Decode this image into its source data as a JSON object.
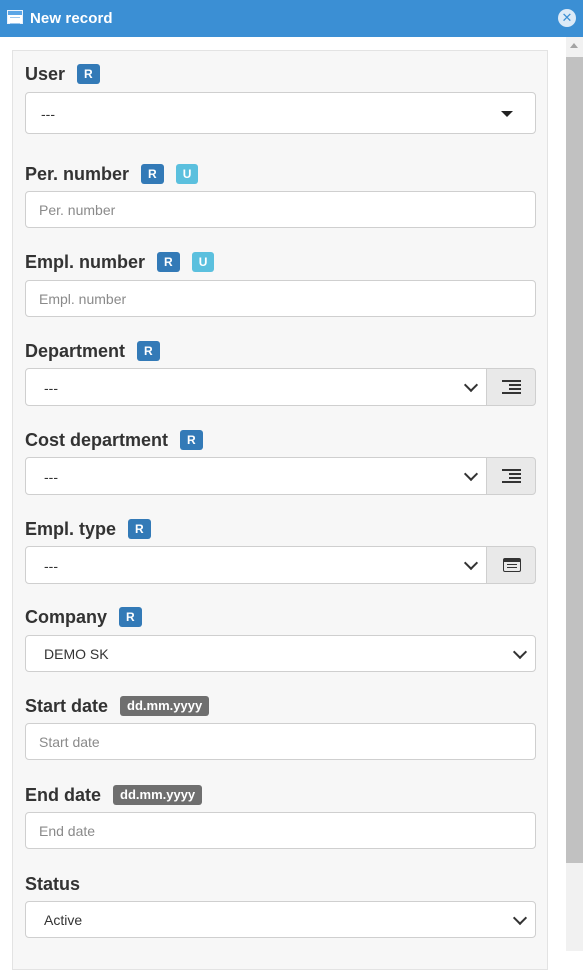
{
  "window": {
    "title": "New record"
  },
  "badges": {
    "r": "R",
    "u": "U",
    "date_format": "dd.mm.yyyy"
  },
  "fields": {
    "user": {
      "label": "User",
      "value": "---"
    },
    "per_number": {
      "label": "Per. number",
      "placeholder": "Per. number"
    },
    "empl_number": {
      "label": "Empl. number",
      "placeholder": "Empl. number"
    },
    "department": {
      "label": "Department",
      "value": "---"
    },
    "cost_department": {
      "label": "Cost department",
      "value": "---"
    },
    "empl_type": {
      "label": "Empl. type",
      "value": "---"
    },
    "company": {
      "label": "Company",
      "value": "DEMO SK"
    },
    "start_date": {
      "label": "Start date",
      "placeholder": "Start date"
    },
    "end_date": {
      "label": "End date",
      "placeholder": "End date"
    },
    "status": {
      "label": "Status",
      "value": "Active"
    }
  },
  "icons": {
    "window": "window-icon",
    "close": "close-icon",
    "tree": "indent-list-icon",
    "list": "list-icon"
  },
  "colors": {
    "titlebar": "#3b8fd4",
    "badge_required": "#337ab7",
    "badge_unique": "#5bc0de",
    "badge_format": "#6f6f6f"
  }
}
